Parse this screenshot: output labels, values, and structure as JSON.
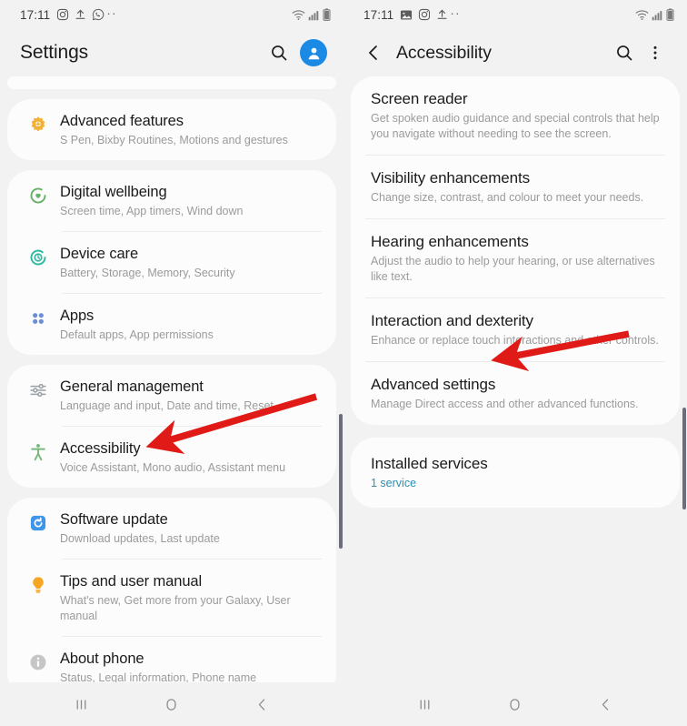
{
  "theme": {
    "page_bg": "#f2f2f2",
    "card_bg": "#fcfcfc",
    "title_color": "#1b1b1b",
    "subtitle_color": "#9b9b9b",
    "accent_link": "#2b8fb0",
    "avatar_blue": "#1a8ae5",
    "arrow_red": "#e01b17",
    "scrollbar": "#6b6e7a"
  },
  "left_panel": {
    "statusbar": {
      "time": "17:11",
      "icons": [
        "instagram-icon",
        "upload-icon",
        "whatsapp-icon"
      ],
      "overflow": "··",
      "right_icons": [
        "wifi-icon",
        "signal-icon",
        "battery-icon"
      ]
    },
    "header": {
      "title": "Settings",
      "search_icon": "search-icon",
      "avatar_icon": "account-avatar-icon"
    },
    "groups": [
      {
        "id": "group-stub",
        "clipped": true,
        "items": []
      },
      {
        "id": "group-advanced",
        "items": [
          {
            "icon": "advanced-features-icon",
            "icon_color": "#f2b134",
            "title": "Advanced features",
            "subtitle": "S Pen, Bixby Routines, Motions and gestures"
          }
        ]
      },
      {
        "id": "group-wellbeing",
        "items": [
          {
            "icon": "digital-wellbeing-icon",
            "icon_color": "#68b268",
            "title": "Digital wellbeing",
            "subtitle": "Screen time, App timers, Wind down"
          },
          {
            "icon": "device-care-icon",
            "icon_color": "#2fb8a0",
            "title": "Device care",
            "subtitle": "Battery, Storage, Memory, Security"
          },
          {
            "icon": "apps-icon",
            "icon_color": "#6b8fd6",
            "title": "Apps",
            "subtitle": "Default apps, App permissions"
          }
        ]
      },
      {
        "id": "group-general",
        "items": [
          {
            "icon": "general-management-icon",
            "icon_color": "#9aa0a6",
            "title": "General management",
            "subtitle": "Language and input, Date and time, Reset"
          },
          {
            "icon": "accessibility-icon",
            "icon_color": "#79b87c",
            "title": "Accessibility",
            "subtitle": "Voice Assistant, Mono audio, Assistant menu"
          }
        ]
      },
      {
        "id": "group-about",
        "items": [
          {
            "icon": "software-update-icon",
            "icon_color": "#3f96e8",
            "title": "Software update",
            "subtitle": "Download updates, Last update"
          },
          {
            "icon": "tips-icon",
            "icon_color": "#f5a623",
            "title": "Tips and user manual",
            "subtitle": "What's new, Get more from your Galaxy, User manual"
          },
          {
            "icon": "about-phone-icon",
            "icon_color": "#bdbdbd",
            "title": "About phone",
            "subtitle": "Status, Legal information, Phone name"
          }
        ]
      }
    ]
  },
  "right_panel": {
    "statusbar": {
      "time": "17:11",
      "icons": [
        "gallery-icon",
        "instagram-icon",
        "upload-icon"
      ],
      "overflow": "··",
      "right_icons": [
        "wifi-icon",
        "signal-icon",
        "battery-icon"
      ]
    },
    "header": {
      "back_icon": "back-chevron-icon",
      "title": "Accessibility",
      "search_icon": "search-icon",
      "menu_icon": "overflow-menu-icon"
    },
    "groups": [
      {
        "id": "group-accessibility-main",
        "items": [
          {
            "title": "Screen reader",
            "subtitle": "Get spoken audio guidance and special controls that help you navigate without needing to see the screen."
          },
          {
            "title": "Visibility enhancements",
            "subtitle": "Change size, contrast, and colour to meet your needs."
          },
          {
            "title": "Hearing enhancements",
            "subtitle": "Adjust the audio to help your hearing, or use alternatives like text."
          },
          {
            "title": "Interaction and dexterity",
            "subtitle": "Enhance or replace touch interactions and other controls."
          },
          {
            "title": "Advanced settings",
            "subtitle": "Manage Direct access and other advanced functions."
          }
        ]
      },
      {
        "id": "group-installed",
        "items": [
          {
            "title": "Installed services",
            "subtitle": "1 service",
            "subtitle_accent": true
          }
        ]
      }
    ]
  },
  "navbar": {
    "buttons": [
      "recents-icon",
      "home-icon",
      "back-icon"
    ]
  },
  "annotations": [
    {
      "id": "arrow-accessibility",
      "target": "Accessibility",
      "panel": "left"
    },
    {
      "id": "arrow-advanced-settings",
      "target": "Advanced settings",
      "panel": "right"
    }
  ]
}
